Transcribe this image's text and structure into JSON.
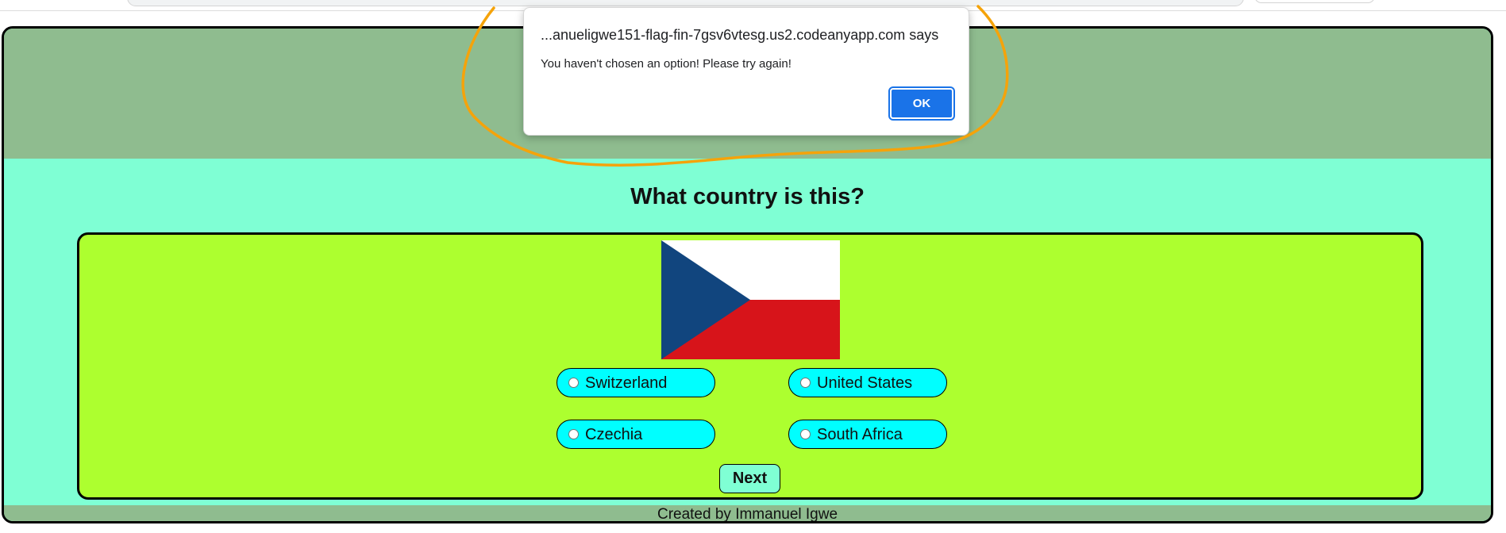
{
  "app": {
    "question": "What country is this?",
    "flag_icon": "czech-flag",
    "options": [
      {
        "label": "Switzerland"
      },
      {
        "label": "United States"
      },
      {
        "label": "Czechia"
      },
      {
        "label": "South Africa"
      }
    ],
    "next_label": "Next",
    "footer": "Created by Immanuel Igwe"
  },
  "dialog": {
    "title": "...anueligwe151-flag-fin-7gsv6vtesg.us2.codeanyapp.com says",
    "message": "You haven't chosen an option! Please try again!",
    "ok_label": "OK"
  },
  "colors": {
    "header_bg": "#8fbc8f",
    "page_bg": "#7fffd4",
    "card_bg": "#adff2f",
    "option_bg": "#00ffff",
    "ok_button": "#1a73e8",
    "annotation_stroke": "#f5a30a",
    "flag_blue": "#11457e",
    "flag_red": "#d7141a",
    "flag_white": "#ffffff"
  }
}
